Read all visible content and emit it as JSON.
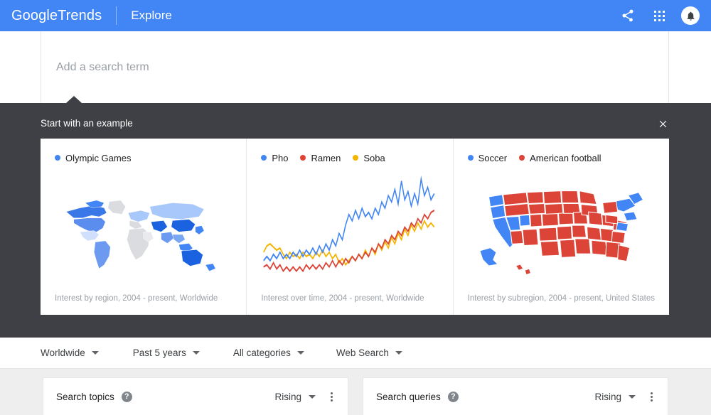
{
  "appbar": {
    "brand_google": "Google",
    "brand_trends": "Trends",
    "explore": "Explore",
    "share_icon": "share-icon",
    "apps_icon": "apps-grid-icon",
    "avatar_icon": "notification-bell-avatar"
  },
  "search": {
    "placeholder": "Add a search term",
    "value": ""
  },
  "overlay": {
    "title": "Start with an example",
    "close_icon": "close-icon",
    "cards": [
      {
        "name": "olympic-games",
        "legend": [
          {
            "label": "Olympic Games",
            "color": "#4285f4"
          }
        ],
        "caption": "Interest by region, 2004 - present, Worldwide",
        "viz": "world-choropleth-map"
      },
      {
        "name": "pho-ramen-soba",
        "legend": [
          {
            "label": "Pho",
            "color": "#4285f4"
          },
          {
            "label": "Ramen",
            "color": "#db4437"
          },
          {
            "label": "Soba",
            "color": "#f4b400"
          }
        ],
        "caption": "Interest over time, 2004 - present, Worldwide",
        "viz": "multi-line-time-series"
      },
      {
        "name": "soccer-american-football",
        "legend": [
          {
            "label": "Soccer",
            "color": "#4285f4"
          },
          {
            "label": "American football",
            "color": "#db4437"
          }
        ],
        "caption": "Interest by subregion, 2004 - present, United States",
        "viz": "united-states-choropleth-map"
      }
    ]
  },
  "filters": [
    {
      "name": "location",
      "label": "Worldwide"
    },
    {
      "name": "time-range",
      "label": "Past 5 years"
    },
    {
      "name": "category",
      "label": "All categories"
    },
    {
      "name": "search-type",
      "label": "Web Search"
    }
  ],
  "panels": [
    {
      "name": "search-topics",
      "title": "Search topics",
      "help": "?",
      "sort": "Rising",
      "menu_icon": "kebab-menu-icon"
    },
    {
      "name": "search-queries",
      "title": "Search queries",
      "help": "?",
      "sort": "Rising",
      "menu_icon": "kebab-menu-icon"
    }
  ],
  "colors": {
    "brand_blue": "#4285f4",
    "overlay_dark": "#3f4045",
    "page_bg": "#eeeeee",
    "red": "#db4437",
    "yellow": "#f4b400"
  }
}
